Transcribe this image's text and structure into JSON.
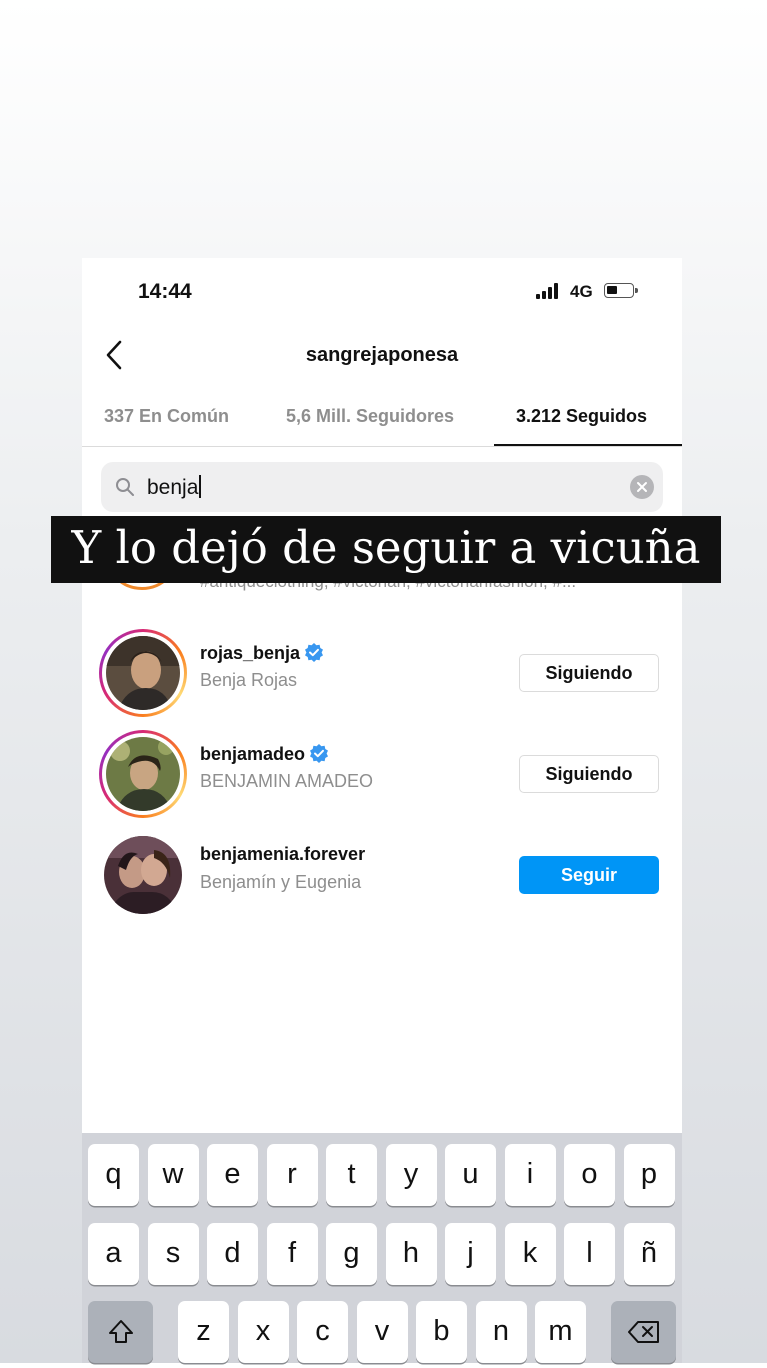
{
  "status_bar": {
    "time": "14:44",
    "network": "4G"
  },
  "header": {
    "title": "sangrejaponesa"
  },
  "tabs": [
    {
      "label": "337 En Común",
      "active": false
    },
    {
      "label": "5,6 Mill. Seguidores",
      "active": false
    },
    {
      "label": "3.212 Seguidos",
      "active": true
    }
  ],
  "search": {
    "query": "benja"
  },
  "partial_row": {
    "text": "#antiqueclothing, #victorian, #victorianfashion, #..."
  },
  "results": [
    {
      "username": "rojas_benja",
      "full_name": "Benja Rojas",
      "verified": true,
      "button": "Siguiendo",
      "story_ring": true
    },
    {
      "username": "benjamadeo",
      "full_name": "BENJAMIN AMADEO",
      "verified": true,
      "button": "Siguiendo",
      "story_ring": true
    },
    {
      "username": "benjamenia.forever",
      "full_name": "Benjamín y Eugenia",
      "verified": false,
      "button": "Seguir",
      "story_ring": false
    }
  ],
  "caption": "Y lo dejó de seguir a vicuña",
  "keyboard": {
    "row1": [
      "q",
      "w",
      "e",
      "r",
      "t",
      "y",
      "u",
      "i",
      "o",
      "p"
    ],
    "row2": [
      "a",
      "s",
      "d",
      "f",
      "g",
      "h",
      "j",
      "k",
      "l",
      "ñ"
    ],
    "row3": [
      "z",
      "x",
      "c",
      "v",
      "b",
      "n",
      "m"
    ]
  },
  "colors": {
    "accent": "#0095f6",
    "verified": "#3897f0",
    "caption_bg": "#111111"
  }
}
